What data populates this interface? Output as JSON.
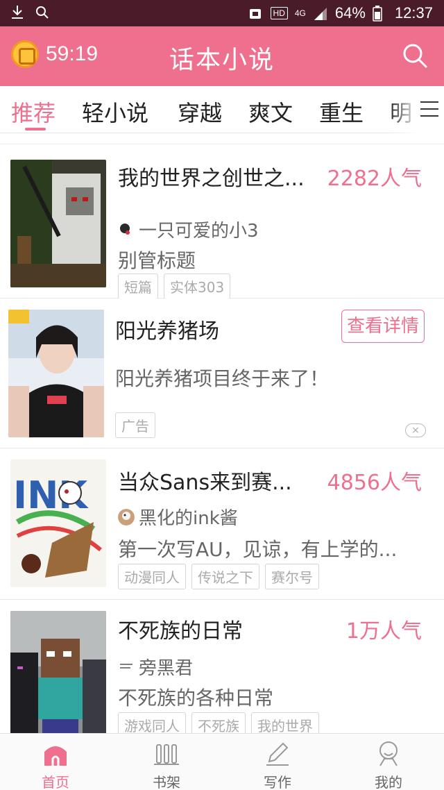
{
  "status_bar": {
    "network": "4G",
    "hd": "HD",
    "battery": "64%",
    "time": "12:37"
  },
  "header": {
    "timer": "59:19",
    "title": "话本小说",
    "accent_color": "#ef6f8f"
  },
  "tabs": [
    {
      "label": "推荐",
      "active": true
    },
    {
      "label": "轻小说",
      "active": false
    },
    {
      "label": "穿越",
      "active": false
    },
    {
      "label": "爽文",
      "active": false
    },
    {
      "label": "重生",
      "active": false
    },
    {
      "label": "明",
      "active": false
    }
  ],
  "items": [
    {
      "title": "我的世界之创世之...",
      "popularity": "2282人气",
      "author": "一只可爱的小3",
      "description": "别管标题",
      "tags": [
        "短篇",
        "实体303"
      ]
    },
    {
      "type": "ad",
      "title": "阳光养猪场",
      "button": "查看详情",
      "description": "阳光养猪项目终于来了！",
      "tag": "广告",
      "close": "×"
    },
    {
      "title": "当众Sans来到赛...",
      "popularity": "4856人气",
      "author": "黑化的ink酱",
      "description": "第一次写AU，见谅，有上学的...",
      "tags": [
        "动漫同人",
        "传说之下",
        "赛尔号"
      ]
    },
    {
      "title": "不死族的日常",
      "popularity": "1万人气",
      "author": "旁黑君",
      "description": "不死族的各种日常",
      "tags": [
        "游戏同人",
        "不死族",
        "我的世界"
      ]
    }
  ],
  "bottom_nav": [
    {
      "label": "首页",
      "icon": "home-icon",
      "active": true
    },
    {
      "label": "书架",
      "icon": "bookshelf-icon",
      "active": false
    },
    {
      "label": "写作",
      "icon": "pen-icon",
      "active": false
    },
    {
      "label": "我的",
      "icon": "profile-icon",
      "active": false
    }
  ]
}
